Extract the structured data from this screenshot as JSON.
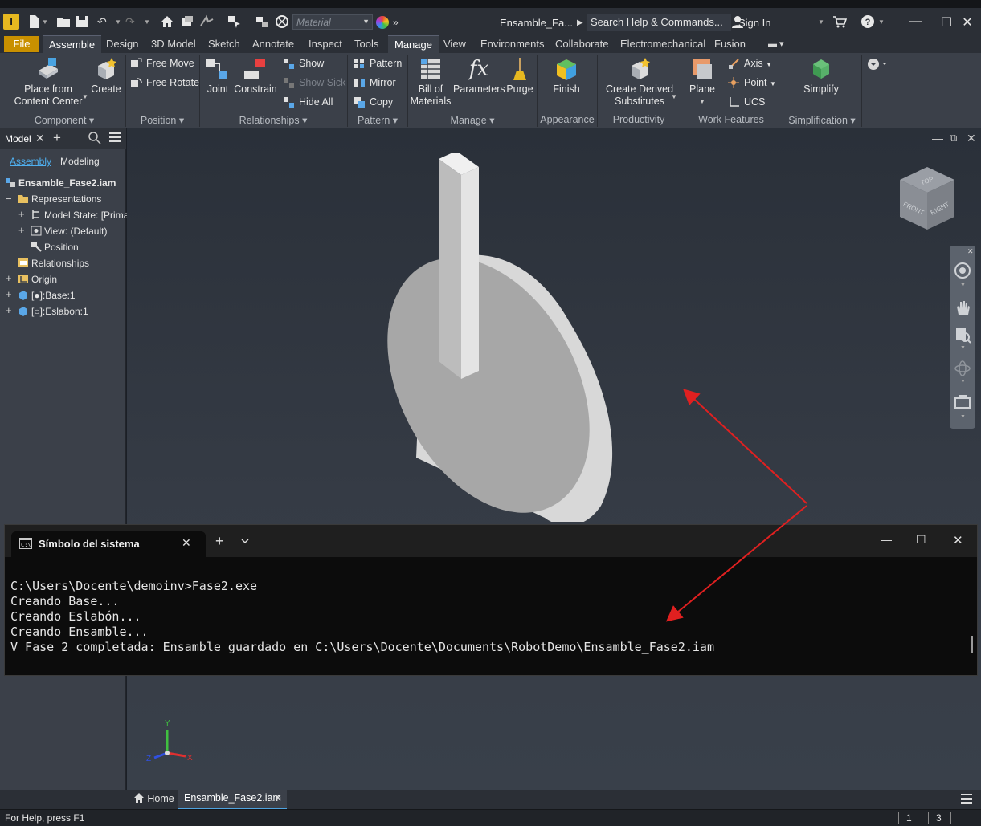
{
  "titlebar": {
    "logo": "I",
    "material": "Material",
    "doc_title": "Ensamble_Fa...",
    "search_placeholder": "Search Help & Commands...",
    "signin": "Sign In"
  },
  "ribbon_tabs": [
    {
      "label": "File"
    },
    {
      "label": "Assemble",
      "active": true
    },
    {
      "label": "Design"
    },
    {
      "label": "3D Model"
    },
    {
      "label": "Sketch"
    },
    {
      "label": "Annotate"
    },
    {
      "label": "Inspect"
    },
    {
      "label": "Tools"
    },
    {
      "label": "Manage"
    },
    {
      "label": "View"
    },
    {
      "label": "Environments"
    },
    {
      "label": "Collaborate"
    },
    {
      "label": "Electromechanical"
    },
    {
      "label": "Fusion"
    }
  ],
  "ribbon": {
    "component": {
      "label": "Component",
      "place": "Place from\nContent Center",
      "place_l1": "Place from",
      "place_l2": "Content Center",
      "create": "Create"
    },
    "position": {
      "label": "Position",
      "free_move": "Free Move",
      "free_rotate": "Free Rotate"
    },
    "relationships": {
      "label": "Relationships",
      "joint": "Joint",
      "constrain": "Constrain",
      "show": "Show",
      "show_sick": "Show Sick",
      "hide_all": "Hide All"
    },
    "pattern": {
      "label": "Pattern",
      "pattern": "Pattern",
      "mirror": "Mirror",
      "copy": "Copy"
    },
    "manage": {
      "label": "Manage",
      "bom_l1": "Bill of",
      "bom_l2": "Materials",
      "parameters": "Parameters",
      "purge": "Purge"
    },
    "appearance": {
      "label": "Appearance",
      "finish": "Finish"
    },
    "productivity": {
      "label": "Productivity",
      "derived_l1": "Create Derived",
      "derived_l2": "Substitutes"
    },
    "work_features": {
      "label": "Work Features",
      "plane": "Plane",
      "axis": "Axis",
      "point": "Point",
      "ucs": "UCS"
    },
    "simplification": {
      "label": "Simplification",
      "simplify": "Simplify"
    }
  },
  "browser": {
    "tab": "Model",
    "sub_tabs": {
      "assembly": "Assembly",
      "modeling": "Modeling"
    },
    "root": "Ensamble_Fase2.iam",
    "items": [
      {
        "label": "Representations"
      },
      {
        "label": "Model State: [Primar"
      },
      {
        "label": "View: (Default)"
      },
      {
        "label": "Position"
      },
      {
        "label": "Relationships"
      },
      {
        "label": "Origin"
      },
      {
        "label": "[●]:Base:1"
      },
      {
        "label": "[○]:Eslabon:1"
      }
    ]
  },
  "viewcube": {
    "top": "TOP",
    "front": "FRONT",
    "right": "RIGHT"
  },
  "terminal": {
    "title": "Símbolo del sistema",
    "lines": [
      "C:\\Users\\Docente\\demoinv>Fase2.exe",
      "Creando Base...",
      "Creando Eslabón...",
      "Creando Ensamble...",
      "V Fase 2 completada: Ensamble guardado en C:\\Users\\Docente\\Documents\\RobotDemo\\Ensamble_Fase2.iam"
    ]
  },
  "triad": {
    "x": "X",
    "y": "Y",
    "z": "Z"
  },
  "doc_tabs": {
    "home": "Home",
    "active": "Ensamble_Fase2.iam"
  },
  "status": {
    "help": "For Help, press F1",
    "count1": "1",
    "count2": "3"
  },
  "colors": {
    "accent_file": "#c99000",
    "arrow": "#e02020",
    "logo": "#e6b820"
  }
}
